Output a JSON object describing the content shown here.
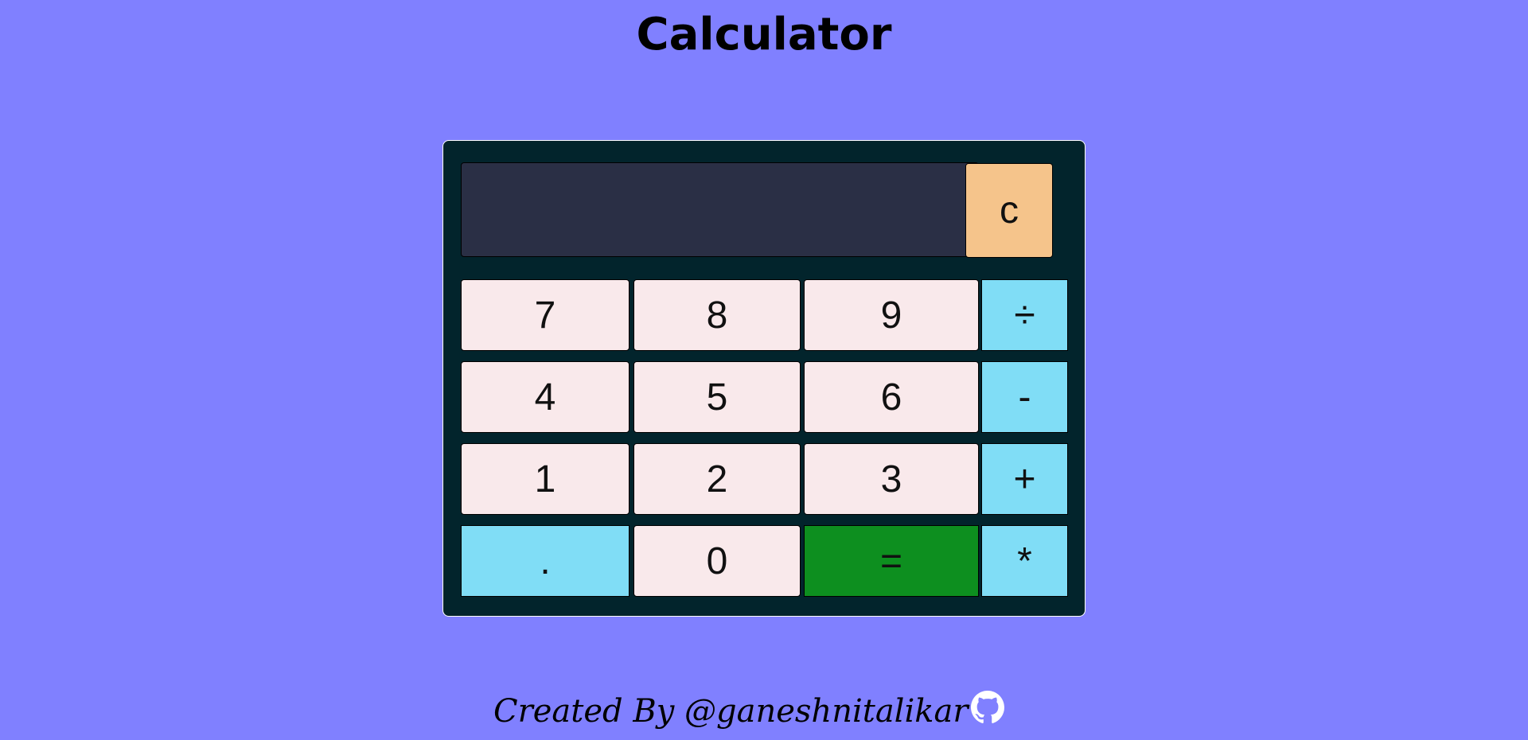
{
  "page": {
    "title": "Calculator"
  },
  "calculator": {
    "display_value": "",
    "clear_label": "c",
    "keys": {
      "seven": "7",
      "eight": "8",
      "nine": "9",
      "divide": "÷",
      "four": "4",
      "five": "5",
      "six": "6",
      "minus": "-",
      "one": "1",
      "two": "2",
      "three": "3",
      "plus": "+",
      "dot": ".",
      "zero": "0",
      "equals": "=",
      "multiply": "*"
    }
  },
  "footer": {
    "created_by": "Created By  @ganeshnitalikar",
    "icon": "github-icon"
  },
  "colors": {
    "background": "#8080ff",
    "calculator_body": "#02242c",
    "display": "#2a2f45",
    "number_key": "#f9e9eb",
    "operator_key": "#80ddf6",
    "clear_key": "#f5c48b",
    "equals_key": "#0d8f1f"
  }
}
